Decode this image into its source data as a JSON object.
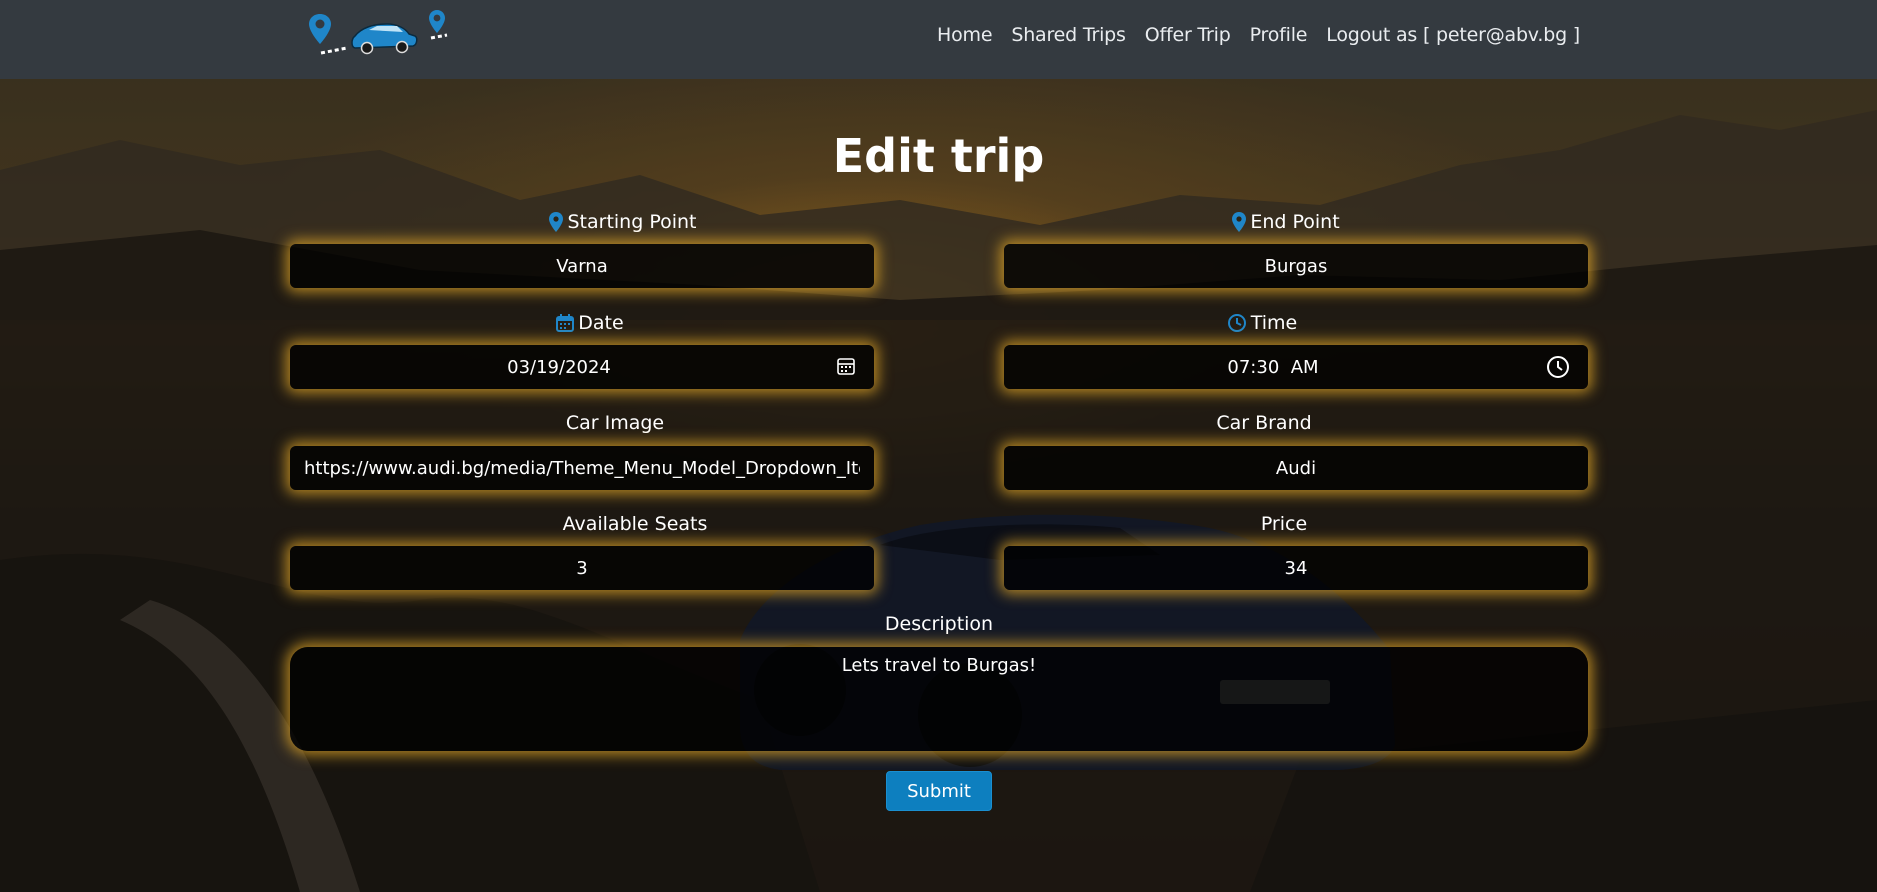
{
  "nav": {
    "links": [
      "Home",
      "Shared Trips",
      "Offer Trip",
      "Profile",
      "Logout as [ peter@abv.bg ]"
    ]
  },
  "page": {
    "title": "Edit trip"
  },
  "form": {
    "starting_point": {
      "label": "Starting Point",
      "value": "Varna"
    },
    "end_point": {
      "label": "End Point",
      "value": "Burgas"
    },
    "date": {
      "label": "Date",
      "value": "03/19/2024"
    },
    "time": {
      "label": "Time",
      "value": "07:30  AM"
    },
    "car_image": {
      "label": "Car Image",
      "value": "https://www.audi.bg/media/Theme_Menu_Model_Dropdown_Item_Image"
    },
    "car_brand": {
      "label": "Car Brand",
      "value": "Audi"
    },
    "available_seats": {
      "label": "Available Seats",
      "value": "3"
    },
    "price": {
      "label": "Price",
      "value": "34"
    },
    "description": {
      "label": "Description",
      "value": "Lets travel to Burgas!"
    },
    "submit_label": "Submit"
  },
  "colors": {
    "navbar": "#343a40",
    "accent_blue": "#0d7fbf",
    "icon_blue": "#1f86c9",
    "glow": "#e6aa28"
  },
  "icons": {
    "logo": "car-route-logo",
    "starting_point": "map-pin-icon",
    "end_point": "map-pin-icon",
    "date": "calendar-icon",
    "time": "clock-icon"
  }
}
